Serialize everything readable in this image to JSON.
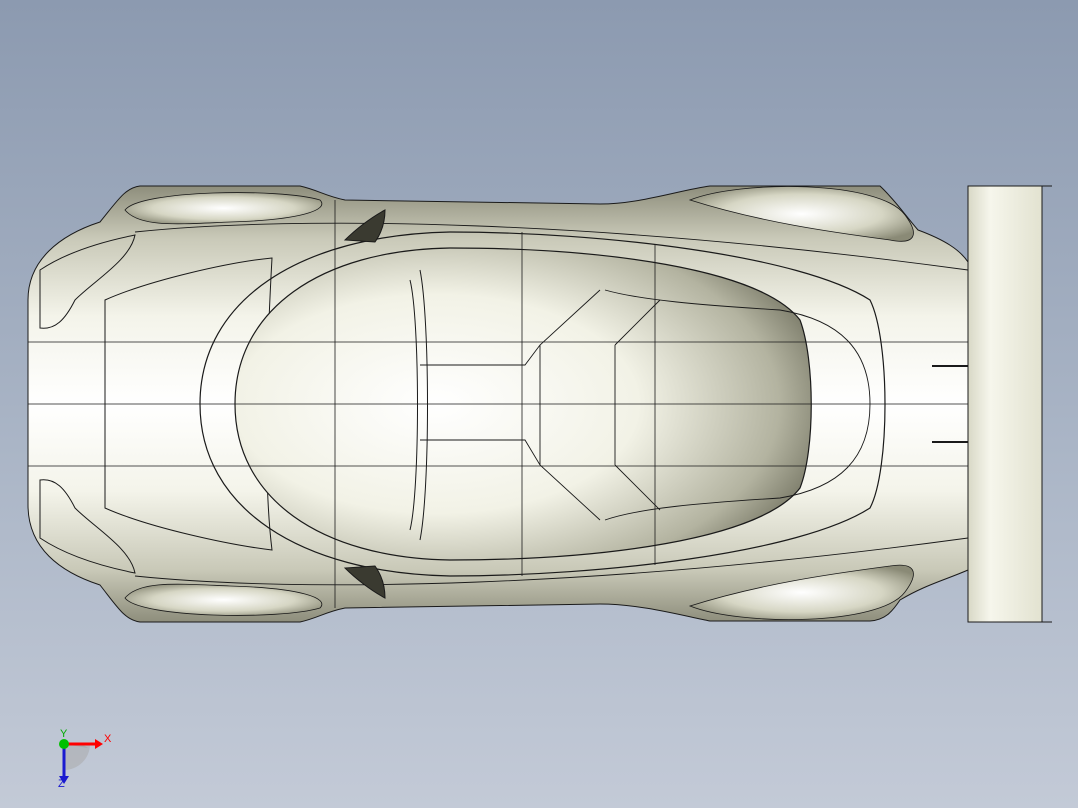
{
  "viewport": {
    "background_top": "#8c9ab0",
    "background_bottom": "#c3cad7"
  },
  "model": {
    "icon": "race-car-top-view",
    "body_color": "#e6e6d6",
    "edge_color": "#1a1a1a"
  },
  "triad": {
    "x_label": "X",
    "y_label": "Y",
    "z_label": "Z",
    "x_color": "#ff0000",
    "y_color": "#00c000",
    "z_color": "#1a1ad0"
  }
}
